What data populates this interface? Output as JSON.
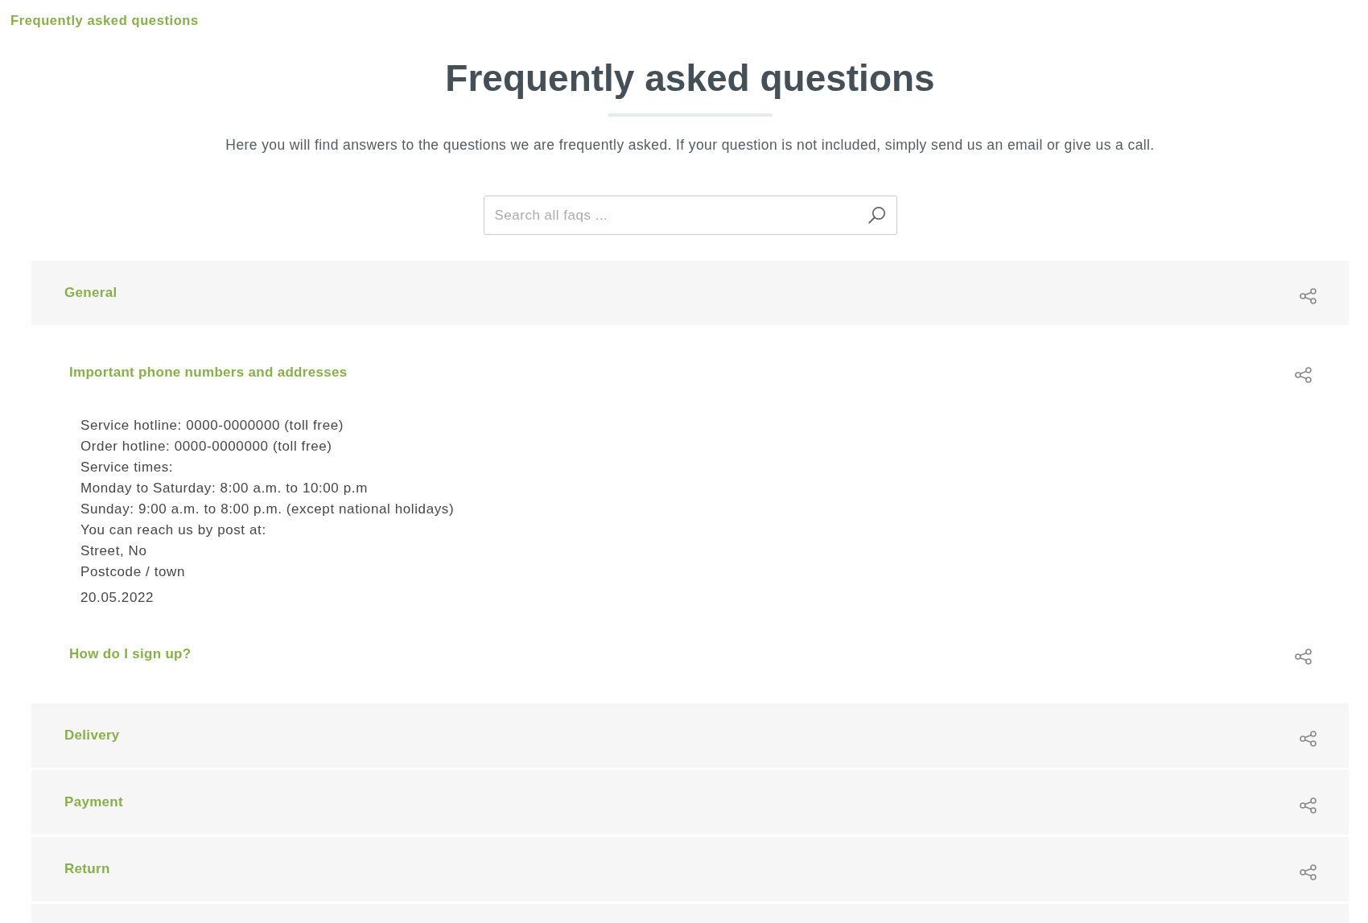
{
  "breadcrumb": "Frequently asked questions",
  "heading": "Frequently asked questions",
  "intro": "Here you will find answers to the questions we are frequently asked. If your question is not included, simply send us an email or give us a call.",
  "search": {
    "placeholder": "Search all faqs ..."
  },
  "categories": [
    {
      "label": "General",
      "questions": [
        {
          "question": "Important phone numbers and addresses",
          "answer_lines": [
            "Service hotline: 0000-0000000 (toll free)",
            "Order hotline: 0000-0000000 (toll free)",
            "Service times:",
            "Monday to Saturday: 8:00 a.m. to 10:00 p.m",
            "Sunday: 9:00 a.m. to 8:00 p.m. (except national holidays)",
            "You can reach us by post at:",
            "Street, No",
            "Postcode / town"
          ],
          "date": "20.05.2022"
        },
        {
          "question": "How do I sign up?"
        }
      ]
    },
    {
      "label": "Delivery"
    },
    {
      "label": "Payment"
    },
    {
      "label": "Return"
    }
  ]
}
